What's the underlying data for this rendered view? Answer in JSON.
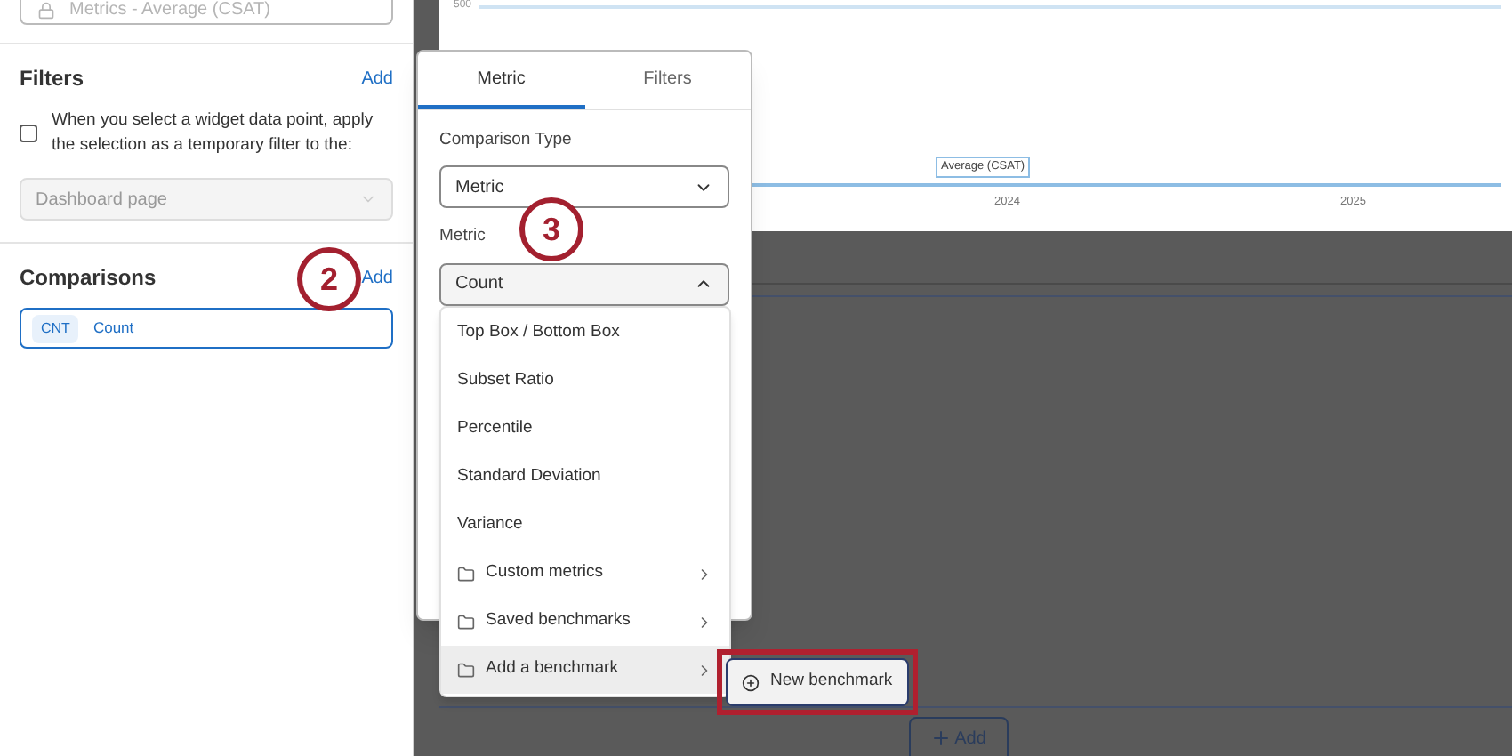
{
  "sidebar": {
    "top_field": {
      "value": "Metrics - Average (CSAT)",
      "disabled": true
    },
    "filters": {
      "title": "Filters",
      "add": "Add",
      "checkbox": {
        "label": "When you select a widget data point, apply the selection as a temporary filter to the:",
        "checked": false
      },
      "select": {
        "value": "Dashboard page",
        "disabled": true
      }
    },
    "comparisons": {
      "title": "Comparisons",
      "add": "Add",
      "items": [
        {
          "tag": "CNT",
          "label": "Count",
          "selected": true
        }
      ]
    }
  },
  "chart": {
    "y_label": "500",
    "legend": "Average (CSAT)",
    "x_labels": [
      "2024",
      "2025"
    ]
  },
  "add_button": {
    "label": "Add"
  },
  "popover": {
    "tabs": [
      {
        "label": "Metric",
        "selected": true
      },
      {
        "label": "Filters",
        "selected": false
      }
    ],
    "comparison_type": {
      "label": "Comparison Type",
      "value": "Metric"
    },
    "metric": {
      "label": "Metric",
      "value": "Count",
      "expanded": true
    }
  },
  "menu": {
    "items": [
      {
        "kind": "option",
        "label": "Top Box / Bottom Box",
        "highlighted": false
      },
      {
        "kind": "option",
        "label": "Subset Ratio",
        "highlighted": false
      },
      {
        "kind": "option",
        "label": "Percentile",
        "highlighted": false
      },
      {
        "kind": "option",
        "label": "Standard Deviation",
        "highlighted": false
      },
      {
        "kind": "option",
        "label": "Variance",
        "highlighted": false
      },
      {
        "kind": "folder",
        "label": "Custom metrics",
        "highlighted": false
      },
      {
        "kind": "folder",
        "label": "Saved benchmarks",
        "highlighted": false
      },
      {
        "kind": "folder",
        "label": "Add a benchmark",
        "highlighted": true
      }
    ]
  },
  "submenu": {
    "label": "New benchmark",
    "emphasized": true
  },
  "annotations": [
    {
      "label": "2"
    },
    {
      "label": "3"
    }
  ]
}
